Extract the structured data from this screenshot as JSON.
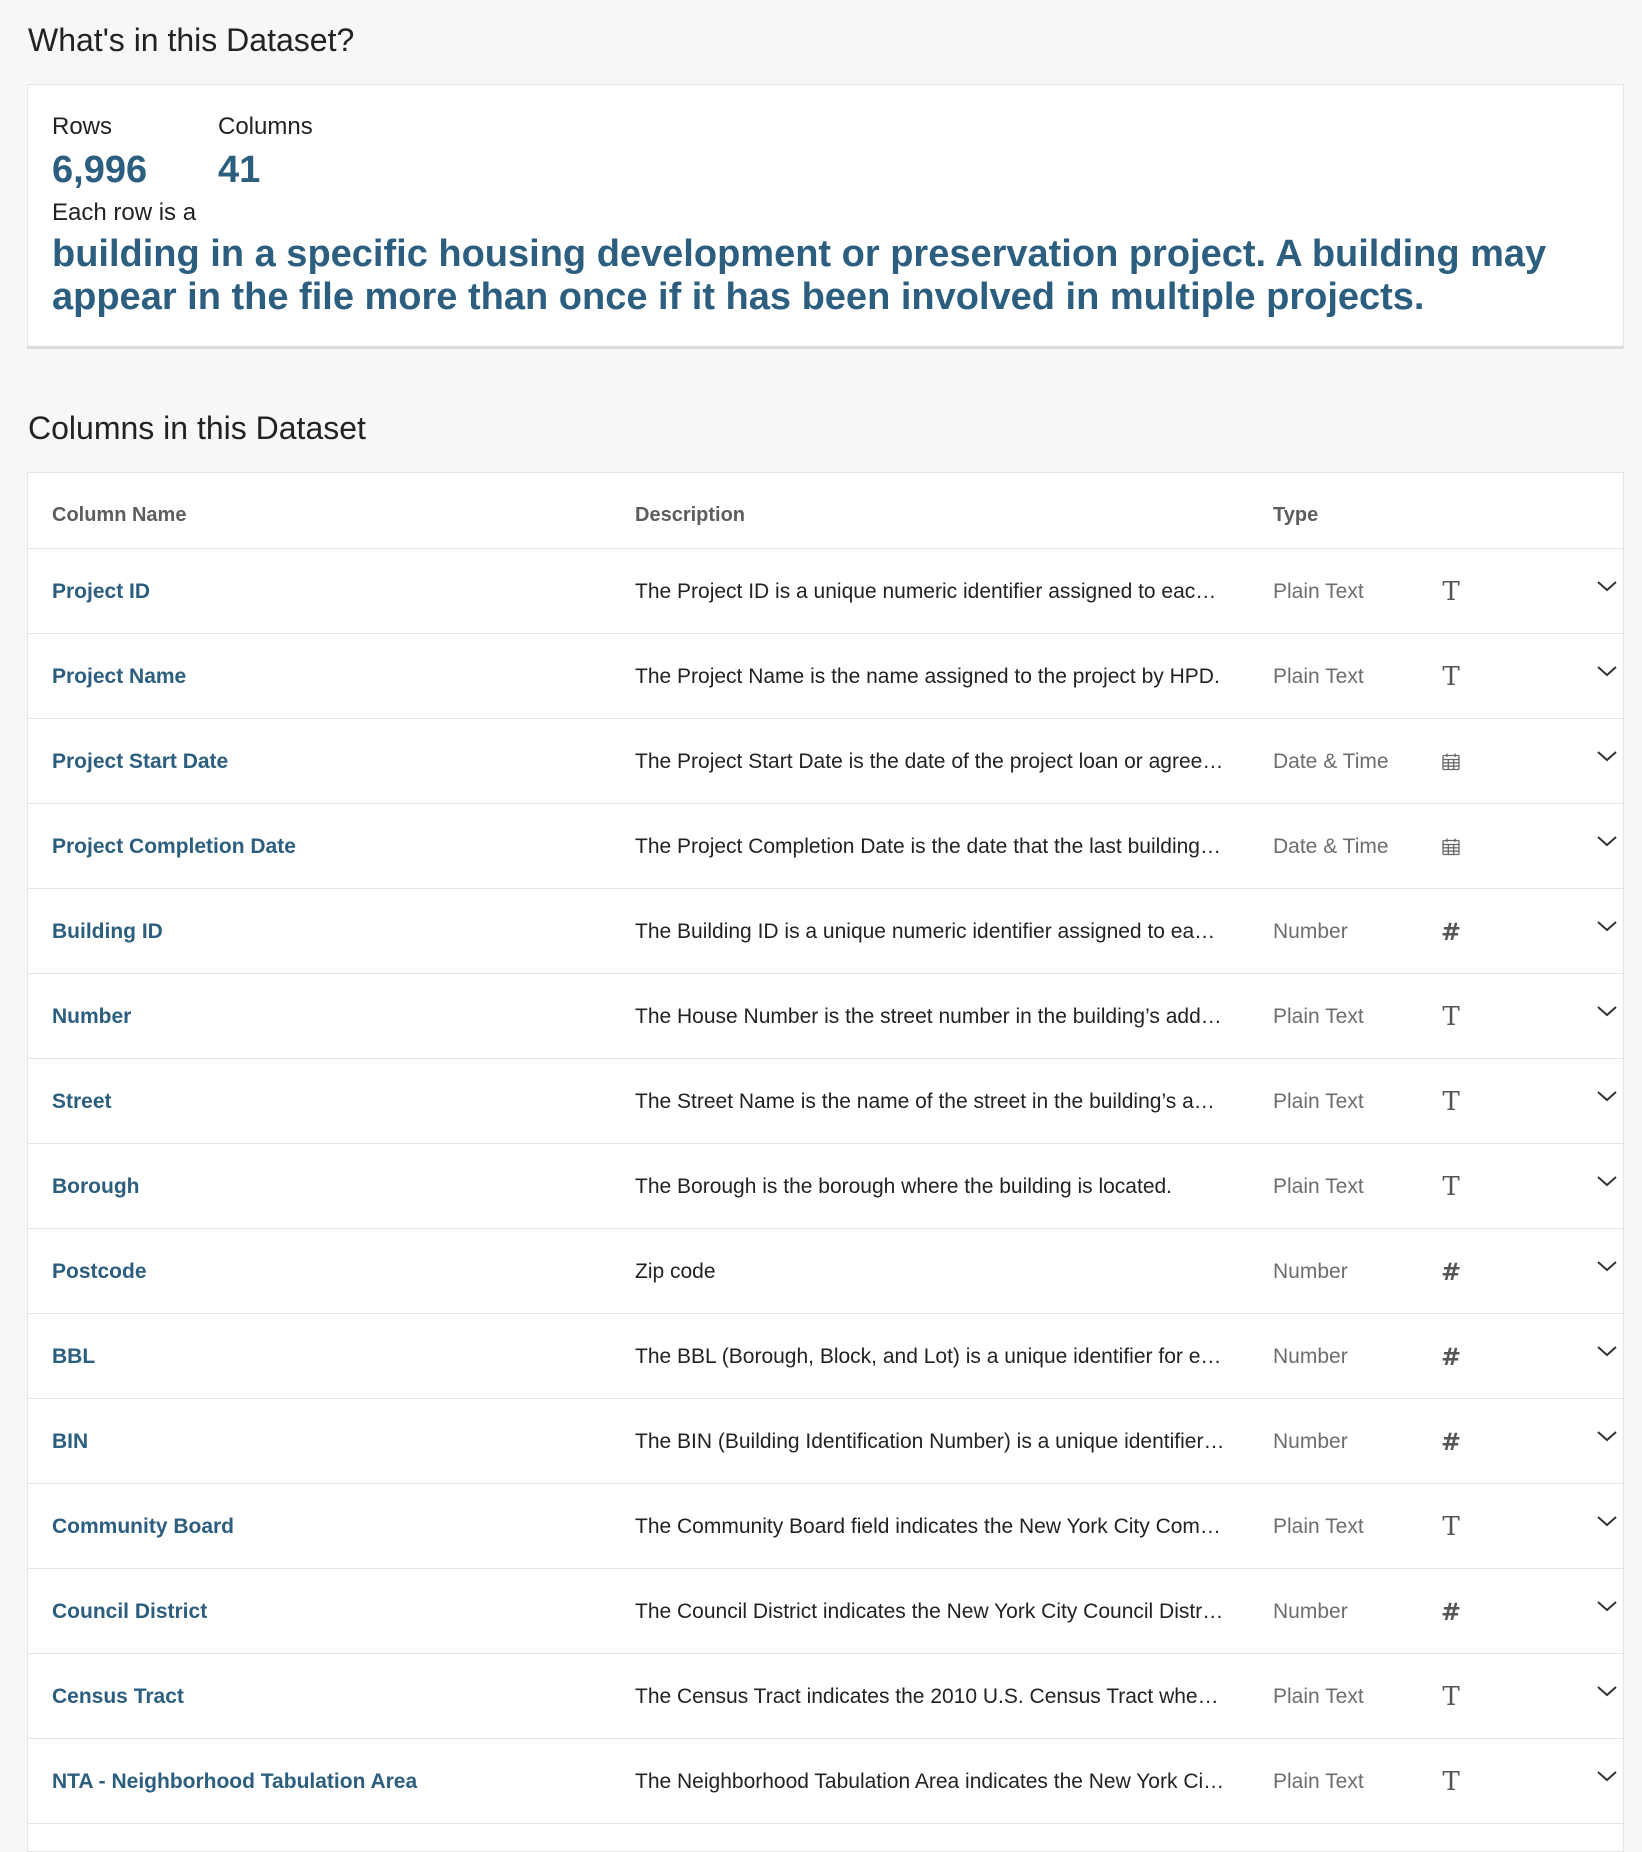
{
  "summary": {
    "title": "What's in this Dataset?",
    "rows_label": "Rows",
    "rows_value": "6,996",
    "columns_label": "Columns",
    "columns_value": "41",
    "row_is_label": "Each row is a",
    "row_is_description": "building in a specific housing development or preservation project. A building may appear in the file more than once if it has been involved in multiple projects."
  },
  "columns_section": {
    "title": "Columns in this Dataset",
    "headers": {
      "name": "Column Name",
      "description": "Description",
      "type": "Type"
    },
    "rows": [
      {
        "name": "Project ID",
        "description": "The Project ID is a unique numeric identifier assigned to each …",
        "type": "Plain Text",
        "icon": "text-icon"
      },
      {
        "name": "Project Name",
        "description": "The Project Name is the name assigned to the project by HPD.",
        "type": "Plain Text",
        "icon": "text-icon"
      },
      {
        "name": "Project Start Date",
        "description": "The Project Start Date is the date of the project loan or agree…",
        "type": "Date & Time",
        "icon": "calendar-icon"
      },
      {
        "name": "Project Completion Date",
        "description": "The Project Completion Date is the date that the last building i…",
        "type": "Date & Time",
        "icon": "calendar-icon"
      },
      {
        "name": "Building ID",
        "description": "The Building ID is a unique numeric identifier assigned to each…",
        "type": "Number",
        "icon": "hash-icon"
      },
      {
        "name": "Number",
        "description": "The House Number is the street number in the building’s addre…",
        "type": "Plain Text",
        "icon": "text-icon"
      },
      {
        "name": "Street",
        "description": "The Street Name is the name of the street in the building’s add…",
        "type": "Plain Text",
        "icon": "text-icon"
      },
      {
        "name": "Borough",
        "description": "The Borough is the borough where the building is located.",
        "type": "Plain Text",
        "icon": "text-icon"
      },
      {
        "name": "Postcode",
        "description": "Zip code",
        "type": "Number",
        "icon": "hash-icon"
      },
      {
        "name": "BBL",
        "description": "The BBL (Borough, Block, and Lot) is a unique identifier for eac…",
        "type": "Number",
        "icon": "hash-icon"
      },
      {
        "name": "BIN",
        "description": "The BIN (Building Identification Number) is a unique identifier f…",
        "type": "Number",
        "icon": "hash-icon"
      },
      {
        "name": "Community Board",
        "description": "The Community Board field indicates the New York City Comm…",
        "type": "Plain Text",
        "icon": "text-icon"
      },
      {
        "name": "Council District",
        "description": "The Council District indicates the New York City Council Distri…",
        "type": "Number",
        "icon": "hash-icon"
      },
      {
        "name": "Census Tract",
        "description": "The Census Tract indicates the 2010 U.S. Census Tract where …",
        "type": "Plain Text",
        "icon": "text-icon"
      },
      {
        "name": "NTA - Neighborhood Tabulation Area",
        "description": "The Neighborhood Tabulation Area indicates the New York Cit…",
        "type": "Plain Text",
        "icon": "text-icon"
      }
    ]
  },
  "colors": {
    "accent": "#2c5e7f",
    "text": "#222222",
    "muted": "#6d6d6d",
    "border": "#e4e4e4",
    "background": "#f7f7f7"
  }
}
